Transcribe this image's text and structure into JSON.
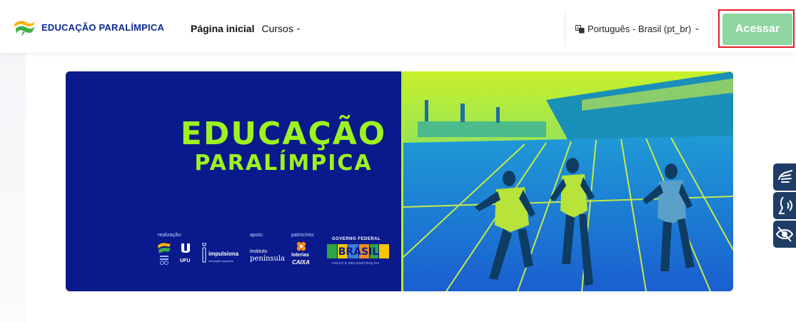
{
  "brand": {
    "name": "EDUCAÇÃO PARALÍMPICA",
    "icon": "paralympic-wave-logo"
  },
  "nav": {
    "home_label": "Página inicial",
    "courses_label": "Cursos"
  },
  "language": {
    "selected": "Português - Brasil (pt_br)",
    "icon": "translate-icon"
  },
  "login": {
    "label": "Acessar"
  },
  "banner": {
    "title_line1": "EDUCAÇÃO",
    "title_line2": "PARALÍMPICA",
    "labels": {
      "realizacao": "realização:",
      "apoio": "apoio:",
      "patrocinio": "patrocínio:"
    },
    "sponsors": {
      "ufu": "UFU",
      "impulsiona": "impulsiona",
      "impulsiona_sub": "educação esportiva",
      "instituto": "instituto",
      "peninsula": "península",
      "loterias": "loterias",
      "caixa": "CAIXA",
      "governo": "GOVERNO FEDERAL",
      "brasil": "BRASIL",
      "brasil_sub": "UNIÃO E RECONSTRUÇÃO"
    }
  },
  "colors": {
    "brand_blue": "#0d2a8f",
    "banner_blue": "#0a1a8c",
    "banner_green": "#9df21f",
    "login_green": "#8fd6a0",
    "highlight_red": "#e21e2a",
    "a11y_navy": "#1f3d66"
  },
  "a11y": {
    "buttons": [
      "sign-language-icon",
      "voice-reader-icon",
      "low-vision-icon"
    ]
  }
}
